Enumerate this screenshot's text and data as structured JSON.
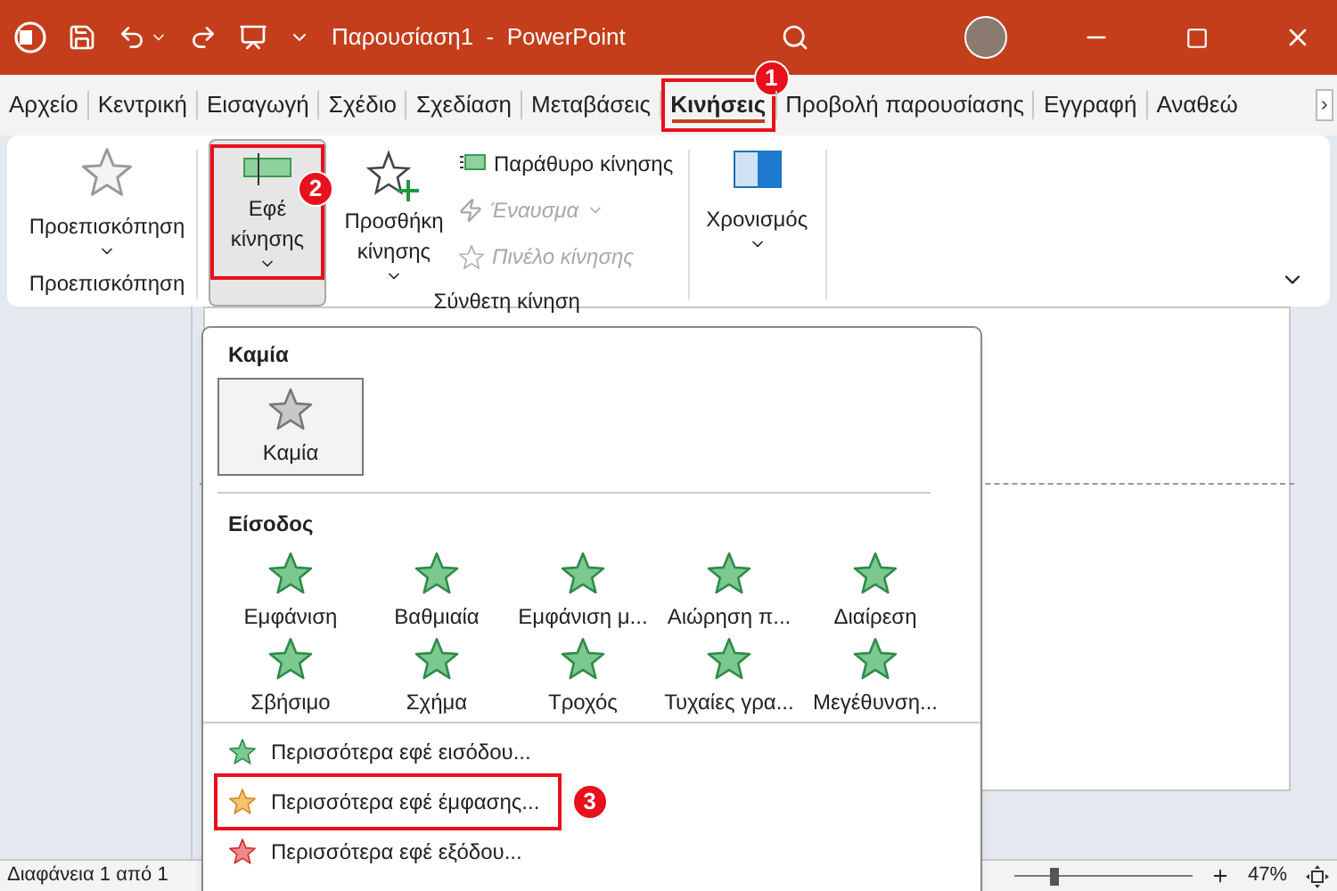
{
  "title_bar": {
    "title": "Παρουσίαση1  -  PowerPoint"
  },
  "tabs": [
    {
      "label": "Αρχείο",
      "selected": false
    },
    {
      "label": "Κεντρική",
      "selected": false
    },
    {
      "label": "Εισαγωγή",
      "selected": false
    },
    {
      "label": "Σχέδιο",
      "selected": false
    },
    {
      "label": "Σχεδίαση",
      "selected": false
    },
    {
      "label": "Μεταβάσεις",
      "selected": false
    },
    {
      "label": "Κινήσεις",
      "selected": true,
      "callout": "1"
    },
    {
      "label": "Προβολή παρουσίασης",
      "selected": false
    },
    {
      "label": "Εγγραφή",
      "selected": false
    },
    {
      "label": "Αναθεώ",
      "selected": false
    }
  ],
  "ribbon": {
    "preview": {
      "button": "Προεπισκόπηση",
      "group_label": "Προεπισκόπηση"
    },
    "effects_button": {
      "label": "Εφέ κίνησης",
      "pressed": true,
      "callout": "2"
    },
    "advanced": {
      "add_button": "Προσθήκη κίνησης",
      "group_label": "Σύνθετη κίνηση",
      "small_buttons": [
        {
          "kind": "pane",
          "label": "Παράθυρο κίνησης",
          "disabled": false
        },
        {
          "kind": "trigger",
          "label": "Έναυσμα",
          "disabled": true
        },
        {
          "kind": "painter",
          "label": "Πινέλο κίνησης",
          "disabled": true
        }
      ]
    },
    "timing_button": "Χρονισμός"
  },
  "menu": {
    "none_heading": "Καμία",
    "none_tile": {
      "label": "Καμία",
      "selected": true
    },
    "entrance_heading": "Είσοδος",
    "effects": [
      "Εμφάνιση",
      "Βαθμιαία",
      "Εμφάνιση μ...",
      "Αιώρηση π...",
      "Διαίρεση",
      "Σβήσιμο",
      "Σχήμα",
      "Τροχός",
      "Τυχαίες γρα...",
      "Μεγέθυνση..."
    ],
    "more": [
      {
        "kind": "entrance",
        "label": "Περισσότερα εφέ εισόδου..."
      },
      {
        "kind": "emphasis",
        "label": "Περισσότερα εφέ έμφασης...",
        "callout": "3"
      },
      {
        "kind": "exit",
        "label": "Περισσότερα εφέ εξόδου..."
      }
    ]
  },
  "status_bar": {
    "slide_counter": "Διαφάνεια 1 από 1",
    "zoom": {
      "level": 0.22
    },
    "zoom_percent": "47%"
  }
}
